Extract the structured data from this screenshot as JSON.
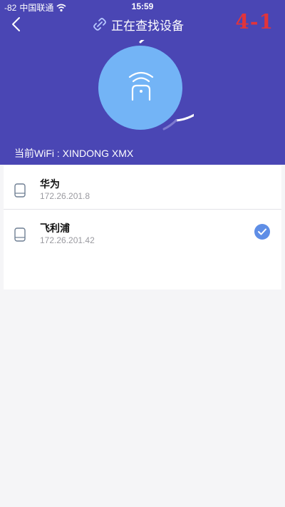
{
  "status_bar": {
    "signal": "-82",
    "carrier": "中国联通",
    "time": "15:59"
  },
  "nav": {
    "title": "正在查找设备",
    "badge": "4-1"
  },
  "wifi": {
    "label": "当前WiFi : XINDONG XMX"
  },
  "devices": [
    {
      "name": "华为",
      "ip": "172.26.201.8",
      "selected": false
    },
    {
      "name": "飞利浦",
      "ip": "172.26.201.42",
      "selected": true
    }
  ],
  "colors": {
    "header_bg": "#4a46b4",
    "radar_disc": "#73b4f6",
    "check": "#5f8ee6",
    "badge": "#e2343a"
  },
  "icons": {
    "back": "chevron-left-icon",
    "nav": "link-icon",
    "radar": "router-wifi-icon",
    "device": "device-icon",
    "check": "check-icon"
  }
}
